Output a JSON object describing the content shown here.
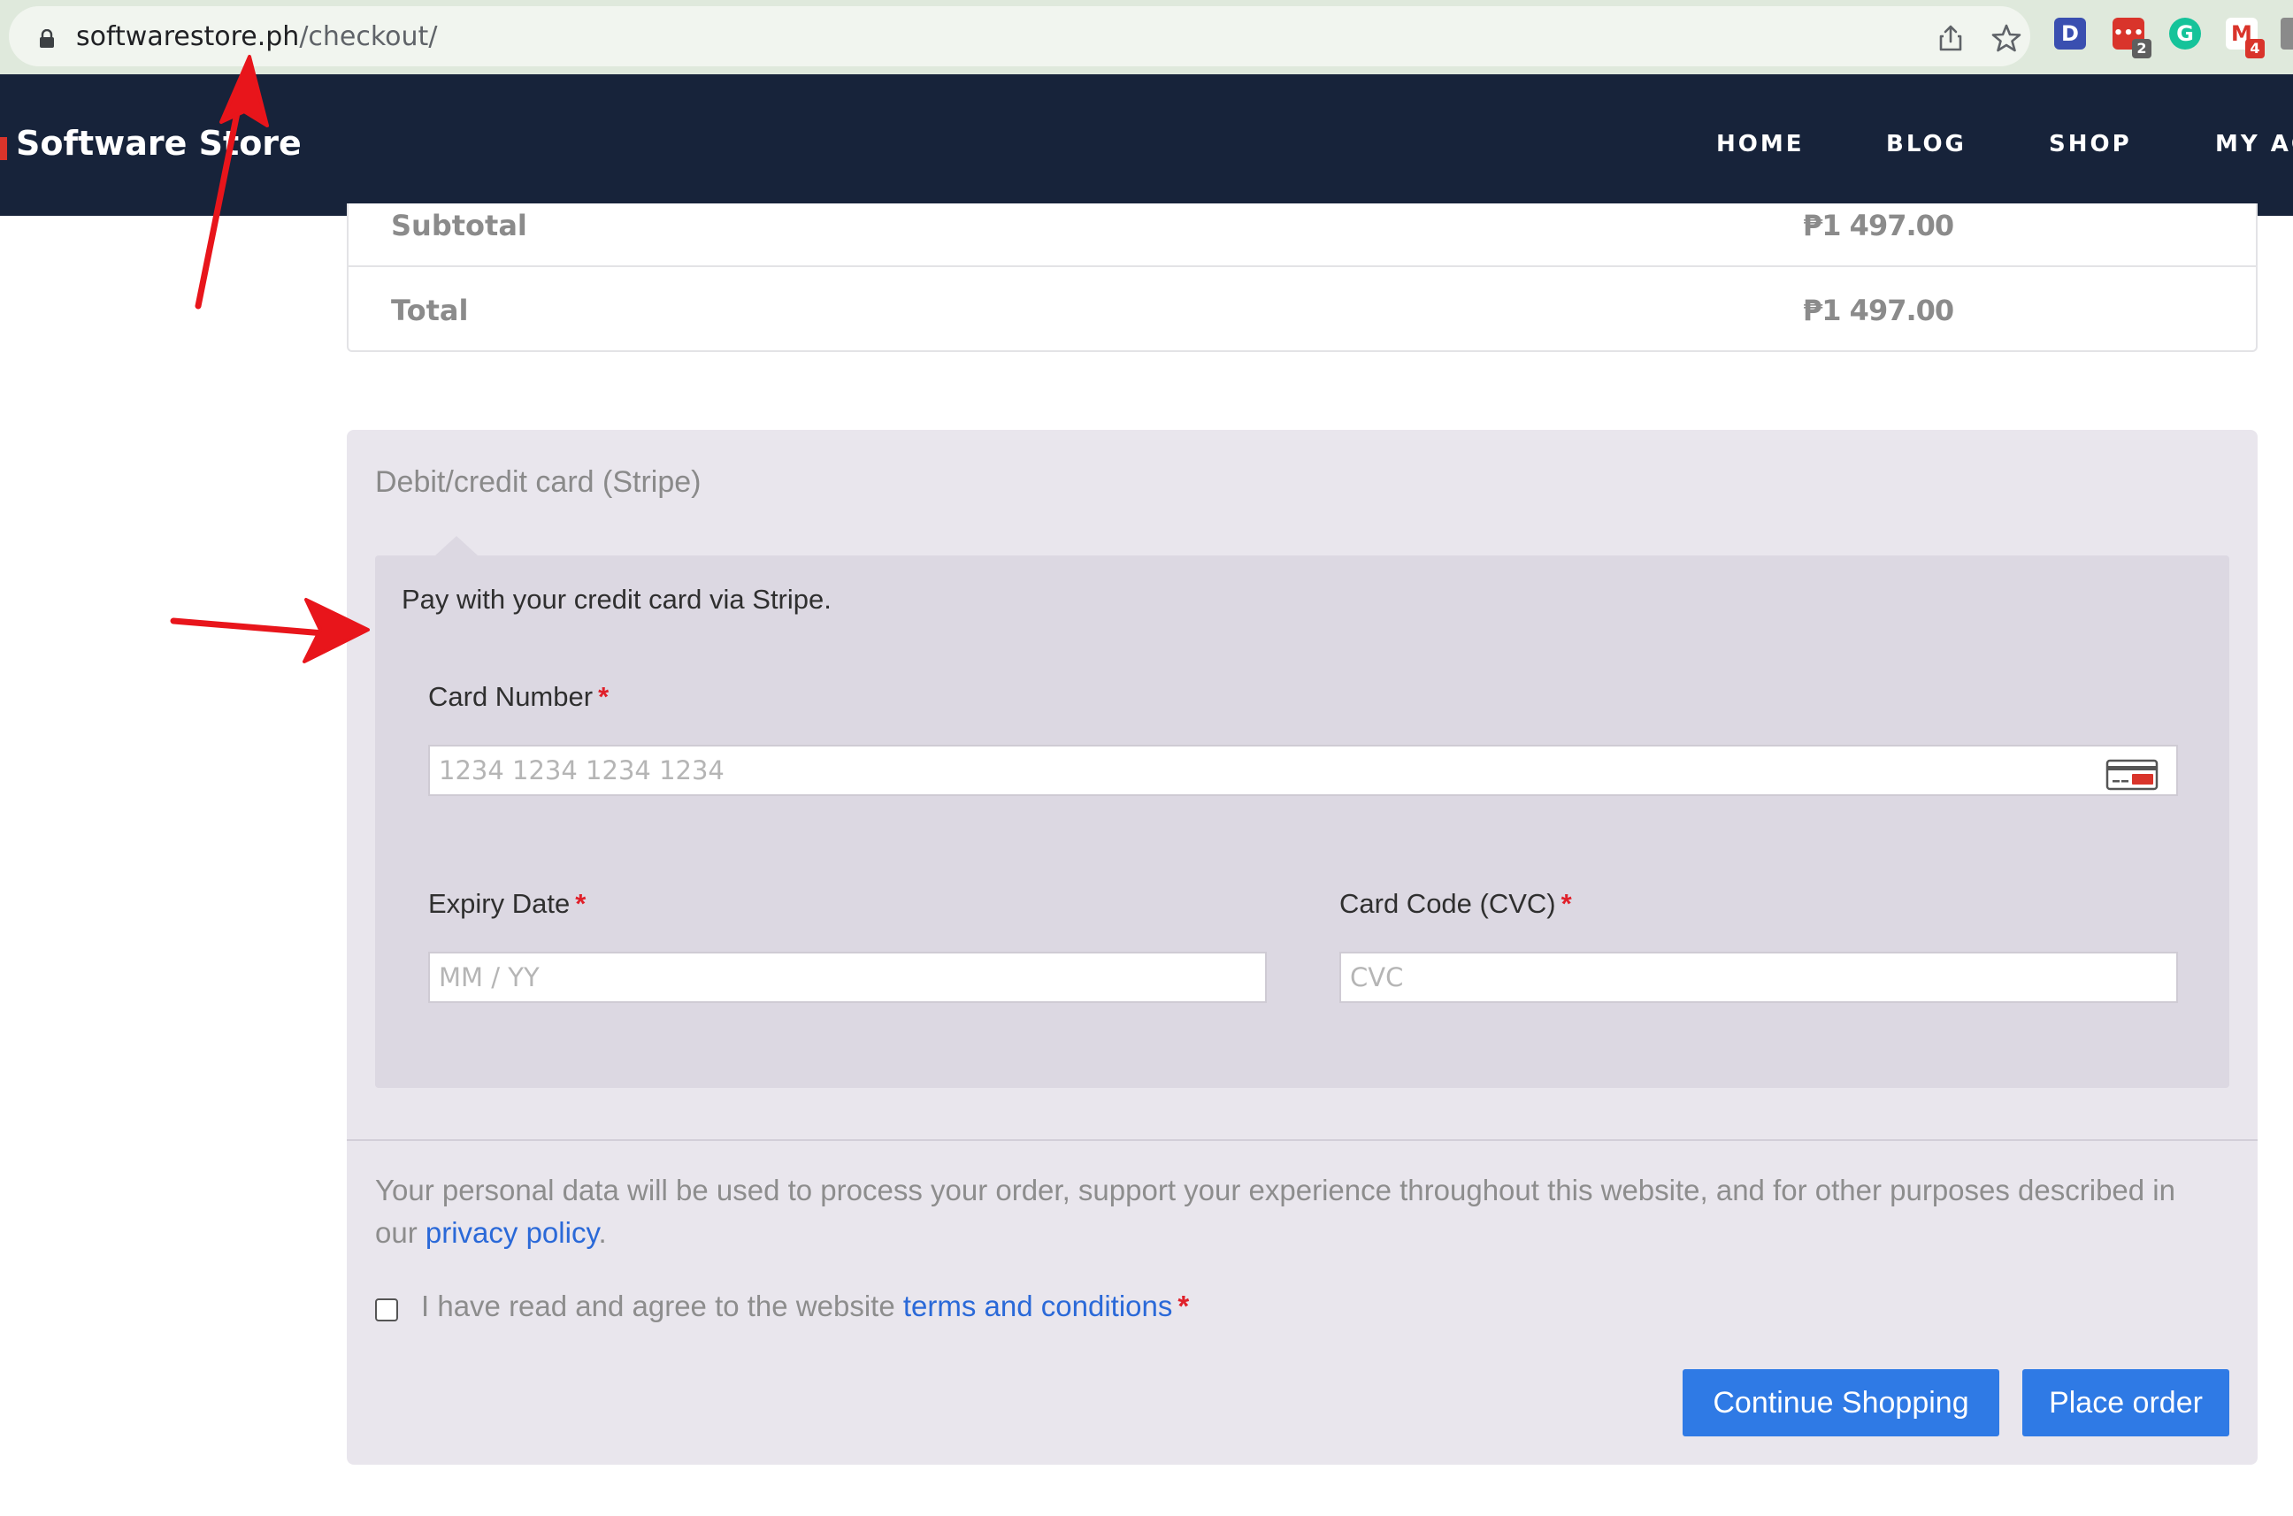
{
  "browser": {
    "url_host": "softwarestore.ph",
    "url_path": "/checkout/",
    "extensions": [
      {
        "name": "D",
        "color": "#3a4fb0",
        "badge": ""
      },
      {
        "name": "•••",
        "color": "#d9342b",
        "badge": "2"
      },
      {
        "name": "G",
        "color": "#15c39a",
        "badge": ""
      },
      {
        "name": "M",
        "color": "#d9342b",
        "badge": "4"
      }
    ]
  },
  "header": {
    "logo": "Software Store",
    "nav": [
      "HOME",
      "BLOG",
      "SHOP",
      "MY AC"
    ]
  },
  "totals": {
    "subtotal_label": "Subtotal",
    "subtotal_value": "₱1 497.00",
    "total_label": "Total",
    "total_value": "₱1 497.00"
  },
  "payment": {
    "method_label": "Debit/credit card (Stripe)",
    "description": "Pay with your credit card via Stripe.",
    "card_number_label": "Card Number",
    "card_number_placeholder": "1234 1234 1234 1234",
    "expiry_label": "Expiry Date",
    "expiry_placeholder": "MM / YY",
    "cvc_label": "Card Code (CVC)",
    "cvc_placeholder": "CVC",
    "required_mark": "*"
  },
  "privacy": {
    "text_before": "Your personal data will be used to process your order, support your experience throughout this website, and for other purposes described in our ",
    "link": "privacy policy",
    "text_after": "."
  },
  "terms": {
    "text": "I have read and agree to the website ",
    "link": "terms and conditions",
    "checked": false
  },
  "buttons": {
    "continue": "Continue Shopping",
    "place_order": "Place order"
  },
  "colors": {
    "header_bg": "#17233a",
    "button_bg": "#2f7ae5",
    "link": "#2a69d8",
    "required": "#e0202a",
    "annotation": "#e8151b"
  }
}
